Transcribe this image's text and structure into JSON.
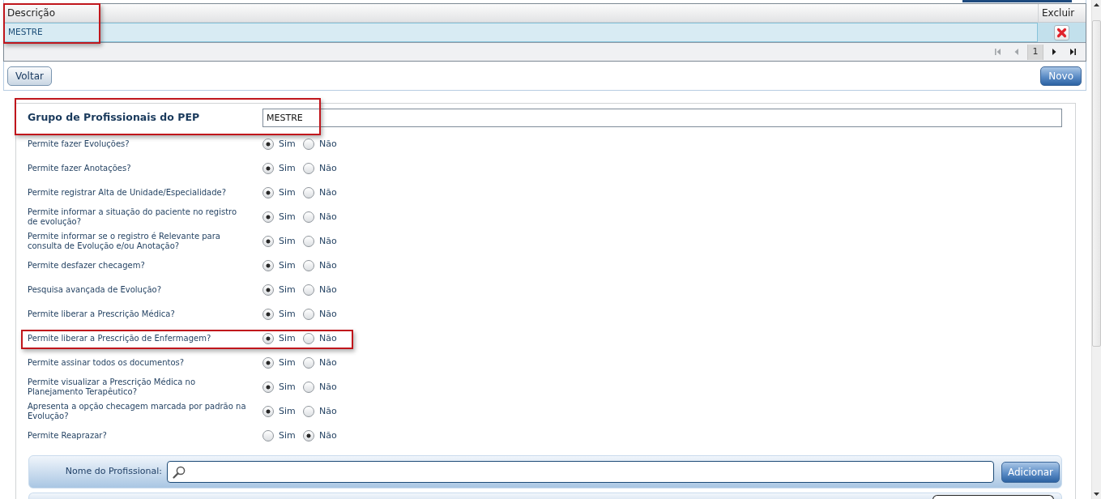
{
  "grid": {
    "highlighted": true,
    "columns": [
      {
        "label": "Descrição"
      },
      {
        "label": "Excluir"
      }
    ],
    "rows": [
      {
        "description": "MESTRE",
        "selected": true
      }
    ],
    "pager": {
      "buttons": [
        {
          "kind": "first",
          "disabled": true
        },
        {
          "kind": "prev",
          "disabled": true
        },
        {
          "kind": "page",
          "label": "1",
          "selected": true
        },
        {
          "kind": "next",
          "disabled": false
        },
        {
          "kind": "last",
          "disabled": false
        }
      ]
    }
  },
  "actions": {
    "back": "Voltar",
    "new": "Novo"
  },
  "form": {
    "title": "Grupo de Profissionais do PEP",
    "value": "MESTRE",
    "highlighted": true,
    "questions": [
      {
        "label": "Permite fazer Evoluções?",
        "highlighted": false,
        "options": [
          {
            "label": "Sim",
            "selected": true
          },
          {
            "label": "Não",
            "selected": false
          }
        ]
      },
      {
        "label": "Permite fazer Anotações?",
        "highlighted": false,
        "options": [
          {
            "label": "Sim",
            "selected": true
          },
          {
            "label": "Não",
            "selected": false
          }
        ]
      },
      {
        "label": "Permite registrar Alta de Unidade/Especialidade?",
        "highlighted": false,
        "options": [
          {
            "label": "Sim",
            "selected": true
          },
          {
            "label": "Não",
            "selected": false
          }
        ]
      },
      {
        "label": "Permite informar a situação do paciente no registro de evolução?",
        "highlighted": false,
        "options": [
          {
            "label": "Sim",
            "selected": true
          },
          {
            "label": "Não",
            "selected": false
          }
        ]
      },
      {
        "label": "Permite informar se o registro é Relevante para consulta de Evolução e/ou Anotação?",
        "highlighted": false,
        "options": [
          {
            "label": "Sim",
            "selected": true
          },
          {
            "label": "Não",
            "selected": false
          }
        ]
      },
      {
        "label": "Permite desfazer checagem?",
        "highlighted": false,
        "options": [
          {
            "label": "Sim",
            "selected": true
          },
          {
            "label": "Não",
            "selected": false
          }
        ]
      },
      {
        "label": "Pesquisa avançada de Evolução?",
        "highlighted": false,
        "options": [
          {
            "label": "Sim",
            "selected": true
          },
          {
            "label": "Não",
            "selected": false
          }
        ]
      },
      {
        "label": "Permite liberar a Prescrição Médica?",
        "highlighted": false,
        "options": [
          {
            "label": "Sim",
            "selected": true
          },
          {
            "label": "Não",
            "selected": false
          }
        ]
      },
      {
        "label": "Permite liberar a Prescrição de Enfermagem?",
        "highlighted": true,
        "options": [
          {
            "label": "Sim",
            "selected": true
          },
          {
            "label": "Não",
            "selected": false
          }
        ]
      },
      {
        "label": "Permite assinar todos os documentos?",
        "highlighted": false,
        "options": [
          {
            "label": "Sim",
            "selected": true
          },
          {
            "label": "Não",
            "selected": false
          }
        ]
      },
      {
        "label": "Permite visualizar a Prescrição Médica no Planejamento Terapêutico?",
        "highlighted": false,
        "options": [
          {
            "label": "Sim",
            "selected": true
          },
          {
            "label": "Não",
            "selected": false
          }
        ]
      },
      {
        "label": "Apresenta a opção checagem marcada por padrão na Evolução?",
        "highlighted": false,
        "options": [
          {
            "label": "Sim",
            "selected": true
          },
          {
            "label": "Não",
            "selected": false
          }
        ]
      },
      {
        "label": "Permite Reaprazar?",
        "highlighted": false,
        "options": [
          {
            "label": "Sim",
            "selected": false
          },
          {
            "label": "Não",
            "selected": true
          }
        ]
      }
    ]
  },
  "professional_search": {
    "label": "Nome do Profissional:",
    "button": "Adicionar"
  }
}
